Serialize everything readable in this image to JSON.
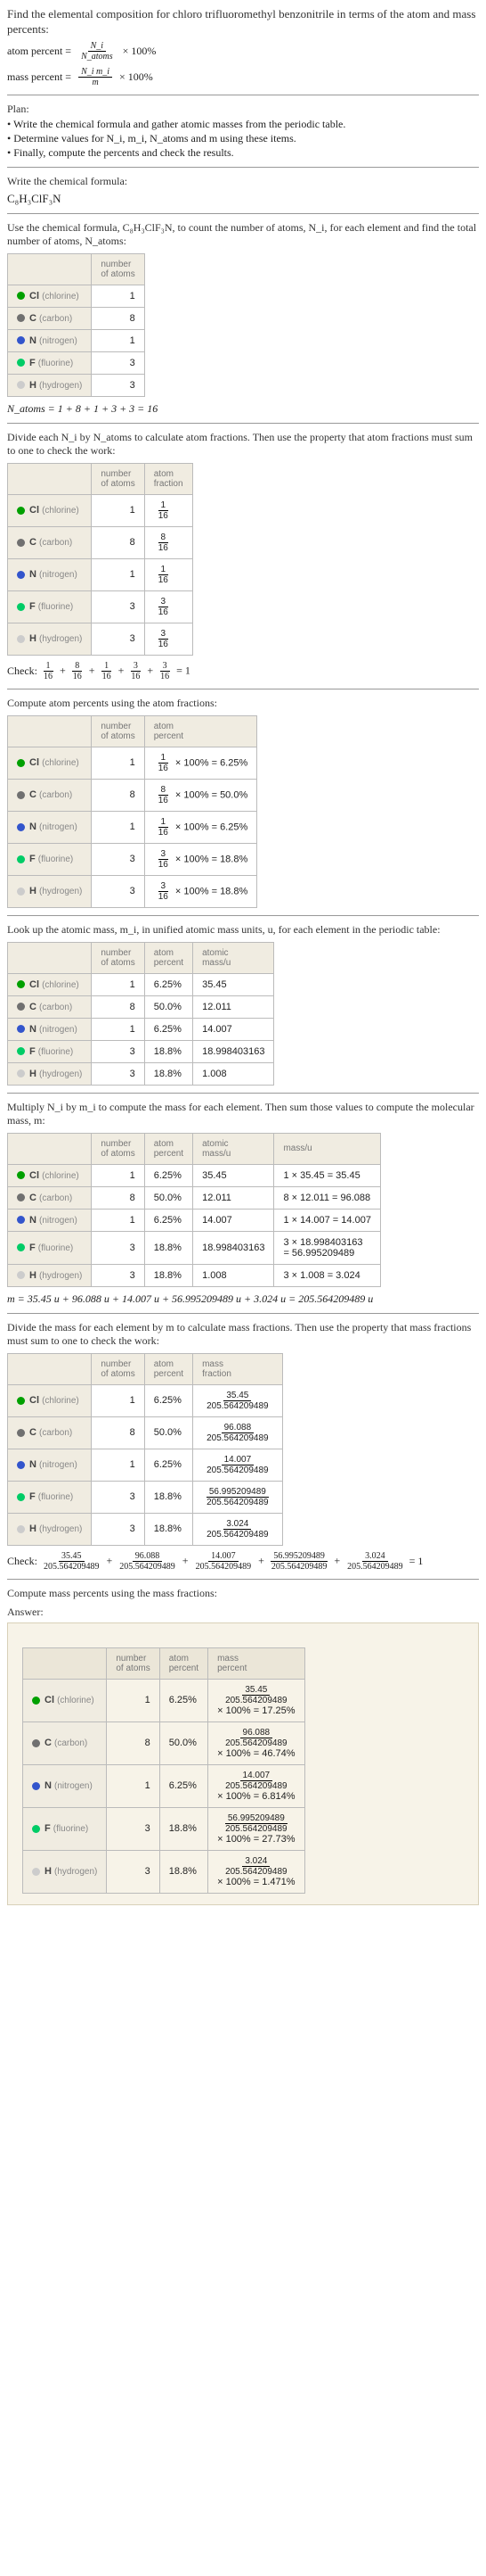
{
  "title": "Find the elemental composition for chloro trifluoromethyl benzonitrile in terms of the atom and mass percents:",
  "f1": {
    "lhs": "atom percent =",
    "num": "N_i",
    "den": "N_atoms",
    "tail": "× 100%"
  },
  "f2": {
    "lhs": "mass percent =",
    "num": "N_i m_i",
    "den": "m",
    "tail": "× 100%"
  },
  "plan_label": "Plan:",
  "plan": [
    "• Write the chemical formula and gather atomic masses from the periodic table.",
    "• Determine values for N_i, m_i, N_atoms and m using these items.",
    "• Finally, compute the percents and check the results."
  ],
  "s1": "Write the chemical formula:",
  "chemformula": "C₈H₃ClF₃N",
  "s2": "Use the chemical formula, C₈H₃ClF₃N, to count the number of atoms, N_i, for each element and find the total number of atoms, N_atoms:",
  "hdr": {
    "atoms": "number\nof atoms",
    "fraction": "atom\nfraction",
    "percent": "atom\npercent",
    "massu": "atomic\nmass/u",
    "mass": "mass/u",
    "massfrac": "mass\nfraction",
    "masspct": "mass\npercent"
  },
  "elems": [
    {
      "color": "#00a000",
      "sym": "Cl",
      "name": "(chlorine)",
      "n": "1"
    },
    {
      "color": "#707070",
      "sym": "C",
      "name": "(carbon)",
      "n": "8"
    },
    {
      "color": "#3355cc",
      "sym": "N",
      "name": "(nitrogen)",
      "n": "1"
    },
    {
      "color": "#00cc66",
      "sym": "F",
      "name": "(fluorine)",
      "n": "3"
    },
    {
      "color": "#cccccc",
      "sym": "H",
      "name": "(hydrogen)",
      "n": "3"
    }
  ],
  "natoms_eq": "N_atoms = 1 + 8 + 1 + 3 + 3 = 16",
  "s3": "Divide each N_i by N_atoms to calculate atom fractions. Then use the property that atom fractions must sum to one to check the work:",
  "fractions": [
    "1/16",
    "8/16",
    "1/16",
    "3/16",
    "3/16"
  ],
  "check1_lhs": "Check:",
  "check1": "1/16 + 8/16 + 1/16 + 3/16 + 3/16 = 1",
  "s4": "Compute atom percents using the atom fractions:",
  "percents": [
    "× 100% = 6.25%",
    "× 100% = 50.0%",
    "× 100% = 6.25%",
    "× 100% = 18.8%",
    "× 100% = 18.8%"
  ],
  "s5": "Look up the atomic mass, m_i, in unified atomic mass units, u, for each element in the periodic table:",
  "pct_simple": [
    "6.25%",
    "50.0%",
    "6.25%",
    "18.8%",
    "18.8%"
  ],
  "masses": [
    "35.45",
    "12.011",
    "14.007",
    "18.998403163",
    "1.008"
  ],
  "s6": "Multiply N_i by m_i to compute the mass for each element. Then sum those values to compute the molecular mass, m:",
  "massprod": [
    "1 × 35.45 = 35.45",
    "8 × 12.011 = 96.088",
    "1 × 14.007 = 14.007",
    "3 × 18.998403163\n= 56.995209489",
    "3 × 1.008 = 3.024"
  ],
  "m_eq": "m = 35.45 u + 96.088 u + 14.007 u + 56.995209489 u + 3.024 u = 205.564209489 u",
  "s7": "Divide the mass for each element by m to calculate mass fractions. Then use the property that mass fractions must sum to one to check the work:",
  "mfrac_num": [
    "35.45",
    "96.088",
    "14.007",
    "56.995209489",
    "3.024"
  ],
  "mfrac_den": "205.564209489",
  "check2": "= 1",
  "s8": "Compute mass percents using the mass fractions:",
  "answer_label": "Answer:",
  "masspct": [
    "× 100% = 17.25%",
    "× 100% = 46.74%",
    "× 100% = 6.814%",
    "× 100% = 27.73%",
    "× 100% = 1.471%"
  ]
}
